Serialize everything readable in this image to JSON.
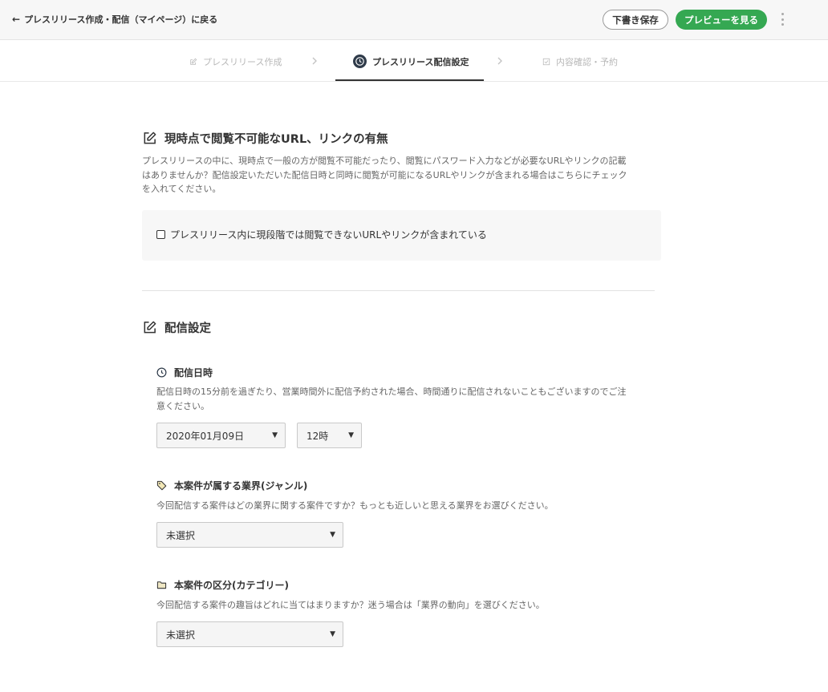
{
  "header": {
    "back_label": "プレスリリース作成・配信（マイページ）に戻る",
    "draft_label": "下書き保存",
    "preview_label": "プレビューを見る"
  },
  "steps": [
    {
      "label": "プレスリリース作成",
      "state": "inactive"
    },
    {
      "label": "プレスリリース配信設定",
      "state": "active"
    },
    {
      "label": "内容確認・予約",
      "state": "inactive"
    }
  ],
  "url_section": {
    "title": "現時点で閲覧不可能なURL、リンクの有無",
    "description_lines": [
      "プレスリリースの中に、現時点で一般の方が閲覧不可能だったり、閲覧にパスワード入力などが必要なURLやリンクの記載",
      "はありませんか？配信設定いただいた配信日時と同時に閲覧が可能になるURLやリンクが含まれる場合はこちらにチェック",
      "を入れてください。"
    ],
    "checkbox_label": "プレスリリース内に現段階では閲覧できないURLやリンクが含まれている",
    "checked": false
  },
  "delivery": {
    "title": "配信設定",
    "datetime": {
      "title": "配信日時",
      "description_lines": [
        "配信日時の15分前を過ぎたり、営業時間外に配信予約された場合、時間通りに配信されないこともございますのでご注",
        "意ください。"
      ],
      "date_value": "2020年01月09日",
      "hour_value": "12時"
    },
    "industry": {
      "title": "本案件が属する業界(ジャンル)",
      "description": "今回配信する案件はどの業界に関する案件ですか？もっとも近しいと思える業界をお選びください。",
      "value": "未選択"
    },
    "category": {
      "title": "本案件の区分(カテゴリー)",
      "description": "今回配信する案件の趣旨はどれに当てはまりますか？迷う場合は「業界の動向」を選びください。",
      "value": "未選択"
    }
  },
  "colors": {
    "accent_green": "#35a852",
    "active_step": "#333333",
    "inactive_step": "#b8b8b8"
  }
}
